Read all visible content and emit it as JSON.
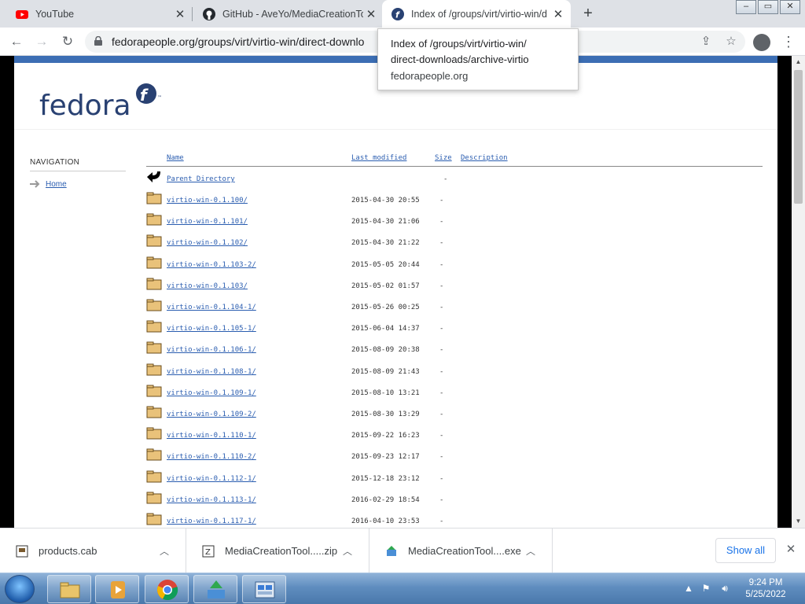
{
  "tabs": [
    {
      "title": "YouTube",
      "icon": "youtube-icon",
      "state": "inactive"
    },
    {
      "title": "GitHub - AveYo/MediaCreationTo",
      "icon": "github-icon",
      "state": "inactive"
    },
    {
      "title": "Index of /groups/virt/virtio-win/d",
      "icon": "fedora-icon",
      "state": "active"
    }
  ],
  "address_bar": {
    "url": "fedorapeople.org/groups/virt/virtio-win/direct-downlo"
  },
  "tooltip": {
    "title_line1": "Index of /groups/virt/virtio-win/",
    "title_line2": "direct-downloads/archive-virtio",
    "domain": "fedorapeople.org"
  },
  "page": {
    "logo_text": "fedora",
    "nav_heading": "NAVIGATION",
    "nav_home": "Home",
    "columns": {
      "name": "Name",
      "modified": "Last modified",
      "size": "Size",
      "description": "Description"
    },
    "parent": {
      "name": "Parent Directory",
      "size": "-"
    },
    "rows": [
      {
        "name": "virtio-win-0.1.100/",
        "modified": "2015-04-30 20:55",
        "size": "-"
      },
      {
        "name": "virtio-win-0.1.101/",
        "modified": "2015-04-30 21:06",
        "size": "-"
      },
      {
        "name": "virtio-win-0.1.102/",
        "modified": "2015-04-30 21:22",
        "size": "-"
      },
      {
        "name": "virtio-win-0.1.103-2/",
        "modified": "2015-05-05 20:44",
        "size": "-"
      },
      {
        "name": "virtio-win-0.1.103/",
        "modified": "2015-05-02 01:57",
        "size": "-"
      },
      {
        "name": "virtio-win-0.1.104-1/",
        "modified": "2015-05-26 00:25",
        "size": "-"
      },
      {
        "name": "virtio-win-0.1.105-1/",
        "modified": "2015-06-04 14:37",
        "size": "-"
      },
      {
        "name": "virtio-win-0.1.106-1/",
        "modified": "2015-08-09 20:38",
        "size": "-"
      },
      {
        "name": "virtio-win-0.1.108-1/",
        "modified": "2015-08-09 21:43",
        "size": "-"
      },
      {
        "name": "virtio-win-0.1.109-1/",
        "modified": "2015-08-10 13:21",
        "size": "-"
      },
      {
        "name": "virtio-win-0.1.109-2/",
        "modified": "2015-08-30 13:29",
        "size": "-"
      },
      {
        "name": "virtio-win-0.1.110-1/",
        "modified": "2015-09-22 16:23",
        "size": "-"
      },
      {
        "name": "virtio-win-0.1.110-2/",
        "modified": "2015-09-23 12:17",
        "size": "-"
      },
      {
        "name": "virtio-win-0.1.112-1/",
        "modified": "2015-12-18 23:12",
        "size": "-"
      },
      {
        "name": "virtio-win-0.1.113-1/",
        "modified": "2016-02-29 18:54",
        "size": "-"
      },
      {
        "name": "virtio-win-0.1.117-1/",
        "modified": "2016-04-10 23:53",
        "size": "-"
      }
    ]
  },
  "downloads": [
    {
      "name": "products.cab",
      "icon": "cab-file-icon"
    },
    {
      "name": "MediaCreationTool.....zip",
      "icon": "zip-file-icon"
    },
    {
      "name": "MediaCreationTool....exe",
      "icon": "exe-file-icon"
    }
  ],
  "download_bar": {
    "show_all": "Show all"
  },
  "taskbar": {
    "time": "9:24 PM",
    "date": "5/25/2022"
  },
  "colors": {
    "fedora_blue": "#3c6eb4",
    "link": "#2a5db0",
    "accent": "#1a73e8"
  }
}
